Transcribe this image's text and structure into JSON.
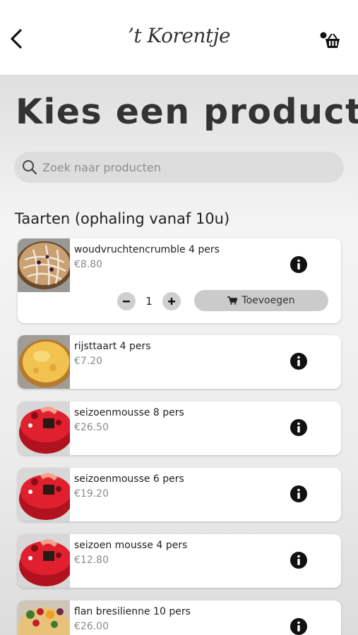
{
  "header": {
    "back_icon": "chevron-left-icon",
    "logo_text": "’t Korentje",
    "cart_icon": "shopping-basket-icon"
  },
  "page": {
    "title": "Kies een product"
  },
  "search": {
    "placeholder": "Zoek naar producten",
    "value": "",
    "icon": "search-icon"
  },
  "section": {
    "title": "Taarten (ophaling vanaf 10u)"
  },
  "products": [
    {
      "name": "woudvruchtencrumble 4 pers",
      "price": "€8.80",
      "image": "crumble-cake",
      "expanded": true,
      "quantity": "1",
      "add_label": "Toevoegen"
    },
    {
      "name": "rijsttaart 4 pers",
      "price": "€7.20",
      "image": "rice-tart"
    },
    {
      "name": "seizoenmousse 8 pers",
      "price": "€26.50",
      "image": "red-mousse-cake"
    },
    {
      "name": "seizoenmousse 6 pers",
      "price": "€19.20",
      "image": "red-mousse-cake"
    },
    {
      "name": "seizoen mousse 4 pers",
      "price": "€12.80",
      "image": "red-mousse-cake"
    },
    {
      "name": "flan bresilienne 10 pers",
      "price": "€26.00",
      "image": "fruit-flan"
    }
  ],
  "colors": {
    "accent_gray": "#cbcbcb",
    "title": "#333333",
    "price": "#8a8a8a"
  }
}
